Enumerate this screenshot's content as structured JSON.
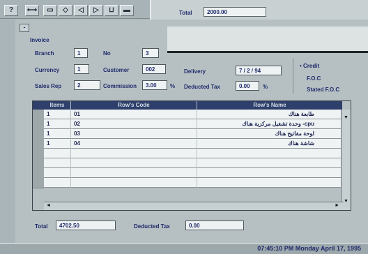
{
  "toolbar": {
    "buttons": [
      "?",
      "⟷",
      "▭",
      "◇",
      "◁",
      "▷",
      "⊔",
      "▬"
    ]
  },
  "top_dialog": {
    "total_label": "Total",
    "total_value": "2000.00"
  },
  "window": {
    "sysmenu": "-"
  },
  "invoice": {
    "heading": "Invoice",
    "branch_label": "Branch",
    "branch_value": "1",
    "no_label": "No",
    "no_value": "3",
    "currency_label": "Currency",
    "currency_value": "1",
    "customer_label": "Customer",
    "customer_value": "002",
    "delivery_label": "Delivery",
    "delivery_value": "7 / 2 / 94",
    "salesrep_label": "Sales Rep",
    "salesrep_value": "2",
    "commission_label": "Commission",
    "commission_value": "3.00",
    "commission_unit": "%",
    "deducted_label": "Deducted Tax",
    "deducted_value": "0.00",
    "deducted_unit": "%",
    "payment_options": [
      "Credit",
      "F.O.C",
      "Stated F.O.C"
    ]
  },
  "grid": {
    "headers": [
      "Items",
      "Row's Code",
      "Row's Name"
    ],
    "rows": [
      {
        "items": "1",
        "code": "01",
        "name": "طابعة  هناك"
      },
      {
        "items": "1",
        "code": "02",
        "name": "وحدة تشغيل مركزية  هناك  -cpu"
      },
      {
        "items": "1",
        "code": "03",
        "name": "لوحة مفاتيح  هناك"
      },
      {
        "items": "1",
        "code": "04",
        "name": "شاشة  هناك"
      },
      {
        "items": "",
        "code": "",
        "name": ""
      },
      {
        "items": "",
        "code": "",
        "name": ""
      },
      {
        "items": "",
        "code": "",
        "name": ""
      },
      {
        "items": "",
        "code": "",
        "name": ""
      }
    ]
  },
  "footer": {
    "total_label": "Total",
    "total_value": "4702.50",
    "deducted_label": "Deducted Tax",
    "deducted_value": "0.00"
  },
  "status": {
    "clock": "07:45:10  PM  Monday April 17, 1995"
  }
}
